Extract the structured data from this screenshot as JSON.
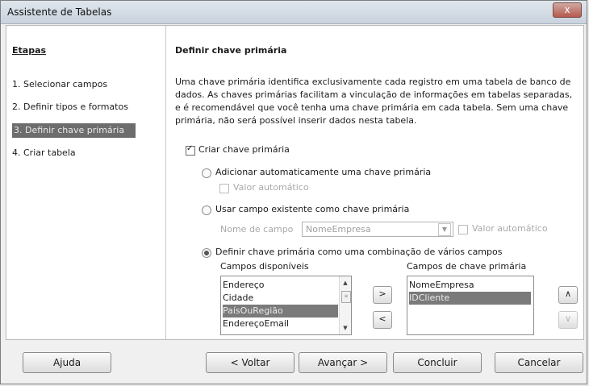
{
  "window": {
    "title": "Assistente de Tabelas",
    "close_glyph": "x"
  },
  "steps": {
    "title": "Etapas",
    "items": [
      {
        "label": "1.  Selecionar campos"
      },
      {
        "label": "2.  Definir tipos e formatos"
      },
      {
        "label": "3.  Definir chave primária",
        "active": true
      },
      {
        "label": "4.  Criar tabela"
      }
    ]
  },
  "page": {
    "title": "Definir chave primária",
    "description": "Uma chave primária identifica exclusivamente cada registro em uma tabela de banco de dados. As chaves primárias facilitam a vinculação de informações em tabelas separadas, e é recomendável que você tenha uma chave primária em cada tabela. Sem uma chave primária, não será possível inserir dados nesta tabela."
  },
  "options": {
    "create_pk": {
      "label": "Criar chave primária",
      "checked": true
    },
    "auto_add": {
      "label": "Adicionar automaticamente uma chave primária",
      "checked": false
    },
    "auto_add_autovalue": {
      "label": "Valor automático",
      "checked": false
    },
    "use_existing": {
      "label": "Usar campo existente como chave primária",
      "checked": false
    },
    "field_name_label": "Nome de campo",
    "field_name_value": "NomeEmpresa",
    "existing_autovalue": {
      "label": "Valor automático",
      "checked": false
    },
    "combination": {
      "label": "Definir chave primária como uma combinação de vários campos",
      "checked": true
    }
  },
  "available_fields": {
    "label": "Campos disponíveis",
    "items": [
      "Endereço",
      "Cidade",
      "PaísOuRegião",
      "EndereçoEmail"
    ],
    "selected_index": 2
  },
  "pk_fields": {
    "label": "Campos de chave primária",
    "items": [
      "NomeEmpresa",
      "IDCliente"
    ],
    "selected_index": 1
  },
  "transfer": {
    "add": ">",
    "remove": "<"
  },
  "order": {
    "up": "∧",
    "down": "∨"
  },
  "buttons": {
    "help": "Ajuda",
    "back": "< Voltar",
    "next": "Avançar >",
    "finish": "Concluir",
    "cancel": "Cancelar"
  }
}
